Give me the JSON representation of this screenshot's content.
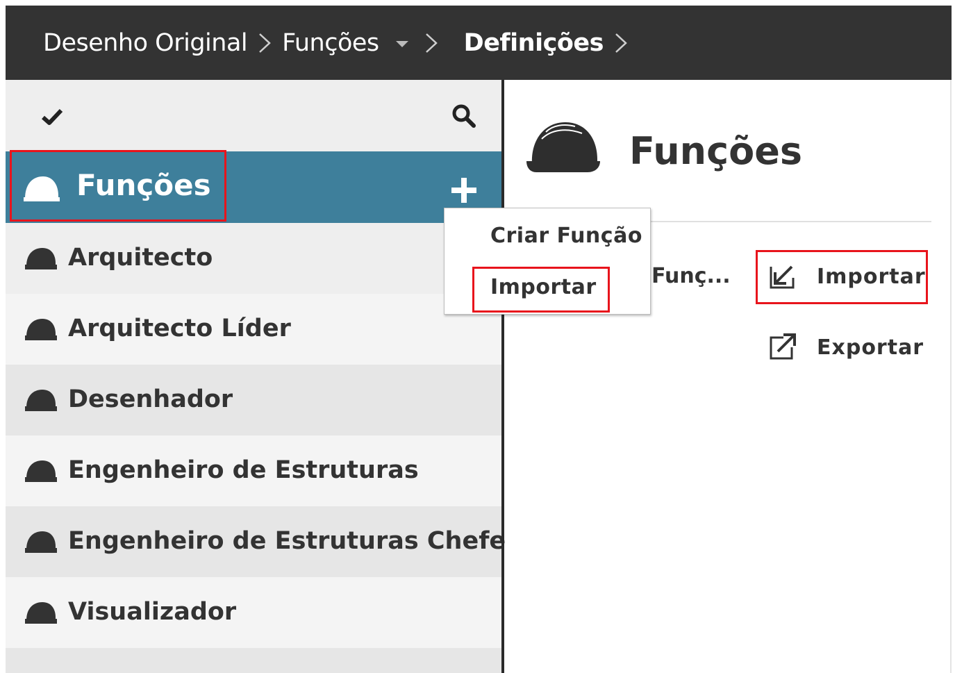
{
  "breadcrumb": {
    "items": [
      {
        "label": "Desenho Original"
      },
      {
        "label": "Funções"
      },
      {
        "label": "Definições"
      }
    ]
  },
  "sidebar": {
    "selected": {
      "label": "Funções",
      "icon": "helmet-icon"
    },
    "items": [
      {
        "label": "Arquitecto"
      },
      {
        "label": "Arquitecto Líder"
      },
      {
        "label": "Desenhador"
      },
      {
        "label": "Engenheiro de Estruturas"
      },
      {
        "label": "Engenheiro de Estruturas Chefe"
      },
      {
        "label": "Visualizador"
      }
    ]
  },
  "dropdown": {
    "items": [
      {
        "label": "Criar Função"
      },
      {
        "label": "Importar"
      }
    ]
  },
  "main": {
    "title": "Funções",
    "truncated_label": "Funç...",
    "actions": [
      {
        "label": "Importar",
        "icon": "import-icon"
      },
      {
        "label": "Exportar",
        "icon": "export-icon"
      }
    ]
  },
  "colors": {
    "topbar": "#333333",
    "selected_row": "#3e7f9b",
    "highlight": "#e8141c",
    "sidebar_bg": "#eeeeee"
  }
}
